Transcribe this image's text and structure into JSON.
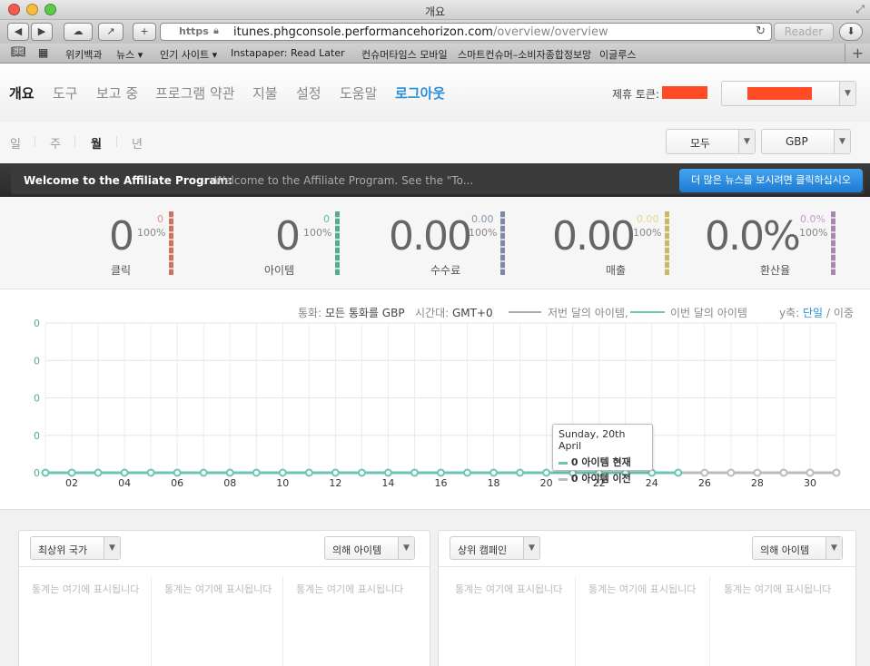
{
  "window": {
    "title": "개요"
  },
  "browser": {
    "https_label": "https",
    "url_host": "itunes.phgconsole.performancehorizon.com",
    "url_path": "/overview/overview",
    "reader_label": "Reader"
  },
  "bookmarks": [
    "위키백과",
    "뉴스 ▾",
    "인기 사이트 ▾",
    "Instapaper: Read Later",
    "컨슈머타임스 모바일",
    "스마트컨슈머–소비자종합정보망",
    "이글루스"
  ],
  "nav": {
    "items": [
      "개요",
      "도구",
      "보고 중",
      "프로그램 약관",
      "지불",
      "설정",
      "도움말",
      "로그아웃"
    ],
    "active": "개요",
    "partner_token_label": "제휴 토큰:"
  },
  "periods": [
    "일",
    "주",
    "월",
    "년"
  ],
  "period_active": "월",
  "filters": {
    "scope": "모두",
    "currency": "GBP"
  },
  "banner": {
    "title": "Welcome to the Affiliate Program:",
    "text": "Welcome to the Affiliate Program. See the \"To...",
    "button": "더 많은 뉴스를 보시려면 클릭하십시오"
  },
  "stats": [
    {
      "value": "0",
      "small": "0",
      "pct": "100%",
      "label": "클릭",
      "color": "#e8907a",
      "bar": "#c97564"
    },
    {
      "value": "0",
      "small": "0",
      "pct": "100%",
      "label": "아이템",
      "color": "#56c0a2",
      "bar": "#5aa88e"
    },
    {
      "value": "0.00",
      "small": "0.00",
      "pct": "100%",
      "label": "수수료",
      "color": "#8796ad",
      "bar": "#7c8ba3"
    },
    {
      "value": "0.00",
      "small": "0.00",
      "pct": "100%",
      "label": "매출",
      "color": "#e6d78a",
      "bar": "#c9b86a"
    },
    {
      "value": "0.0%",
      "small": "0.0%",
      "pct": "100%",
      "label": "환산율",
      "color": "#c898cf",
      "bar": "#a58aae"
    }
  ],
  "chart_legend": {
    "currency_label": "통화:",
    "currency_value": "모든 통화를 GBP",
    "tz_label": "시간대:",
    "tz_value": "GMT+0",
    "prev_label": "저번 달의 아이템,",
    "curr_label": "이번 달의 아이템",
    "yaxis_label": "y축:",
    "yaxis_single": "단일",
    "yaxis_sep": "/",
    "yaxis_double": "이중"
  },
  "chart_data": {
    "type": "line",
    "x": [
      1,
      2,
      3,
      4,
      5,
      6,
      7,
      8,
      9,
      10,
      11,
      12,
      13,
      14,
      15,
      16,
      17,
      18,
      19,
      20,
      21,
      22,
      23,
      24,
      25,
      26,
      27,
      28,
      29,
      30,
      31
    ],
    "xticks": [
      "02",
      "04",
      "06",
      "08",
      "10",
      "12",
      "14",
      "16",
      "18",
      "20",
      "22",
      "24",
      "26",
      "28",
      "30"
    ],
    "yticks": [
      "0",
      "0",
      "0",
      "0",
      "0"
    ],
    "series": [
      {
        "name": "이번 달의 아이템",
        "values": [
          0,
          0,
          0,
          0,
          0,
          0,
          0,
          0,
          0,
          0,
          0,
          0,
          0,
          0,
          0,
          0,
          0,
          0,
          0,
          0,
          0,
          0,
          0,
          0,
          0
        ],
        "color": "#6cc5b2"
      },
      {
        "name": "저번 달의 아이템",
        "values": [
          0,
          0,
          0,
          0,
          0,
          0,
          0,
          0,
          0,
          0,
          0,
          0,
          0,
          0,
          0,
          0,
          0,
          0,
          0,
          0,
          0,
          0,
          0,
          0,
          0,
          0,
          0,
          0,
          0,
          0,
          0
        ],
        "color": "#bbbbbb"
      }
    ],
    "grid": true
  },
  "tooltip": {
    "date": "Sunday, 20th April",
    "current": "0 아이템 현재",
    "previous": "0 아이템 이전"
  },
  "panels": [
    {
      "left_select": "최상위 국가",
      "right_select": "의해 아이템",
      "cells": [
        "통계는 여기에 표시됩니다",
        "통계는 여기에 표시됩니다",
        "통계는 여기에 표시됩니다"
      ]
    },
    {
      "left_select": "상위 캠페인",
      "right_select": "의해 아이템",
      "cells": [
        "통계는 여기에 표시됩니다",
        "통계는 여기에 표시됩니다",
        "통계는 여기에 표시됩니다"
      ]
    }
  ]
}
